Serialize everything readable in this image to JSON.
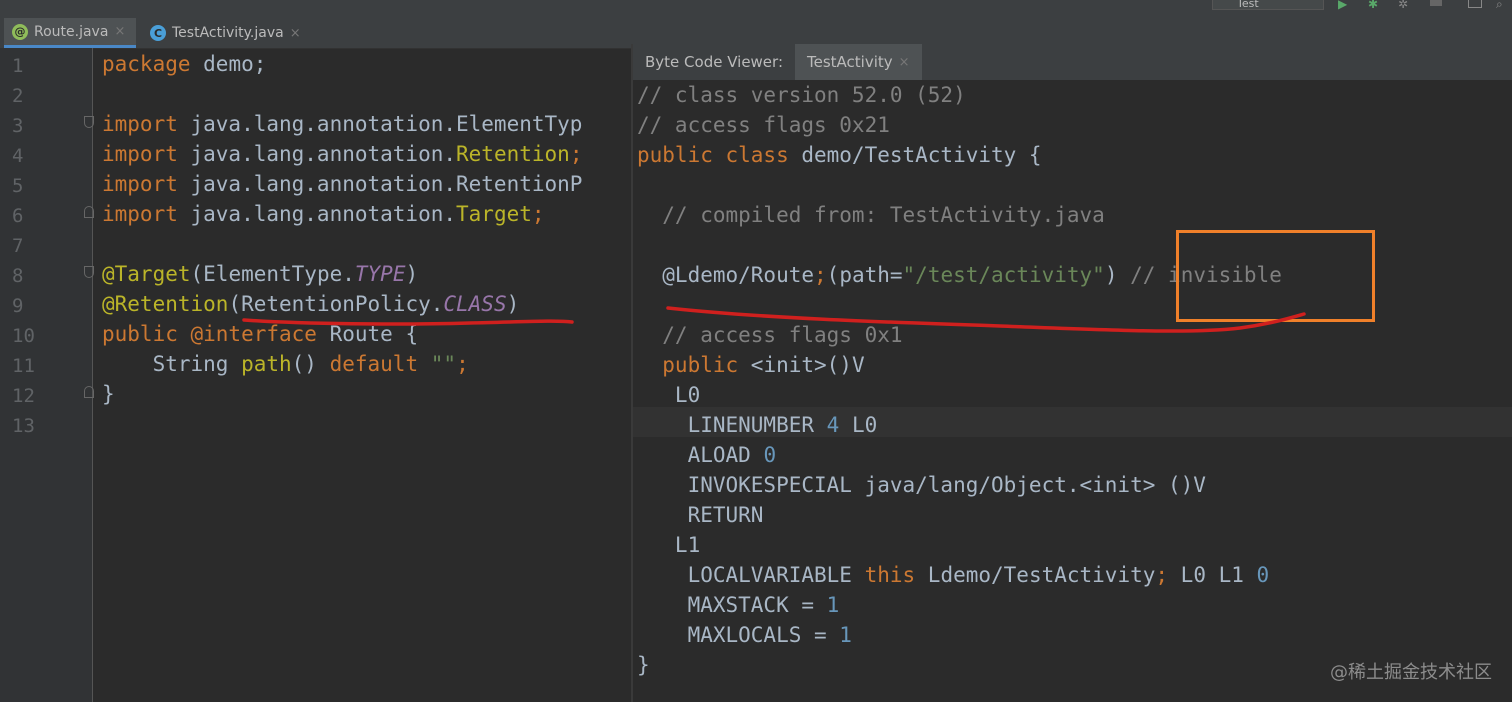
{
  "tabs": [
    {
      "label": "Route.java",
      "icon": "annotation-icon",
      "glyph": "@",
      "color": "#8fbc5a"
    },
    {
      "label": "TestActivity.java",
      "icon": "class-icon",
      "glyph": "C",
      "color": "#4a9fd8"
    }
  ],
  "close_glyph": "×",
  "top_toolbar": {
    "config_label": "Test"
  },
  "line_numbers": [
    "1",
    "2",
    "3",
    "4",
    "5",
    "6",
    "7",
    "8",
    "9",
    "10",
    "11",
    "12",
    "13"
  ],
  "source": {
    "l1_kw": "package",
    "l1_rest": " demo;",
    "l3_kw": "import",
    "l3_rest": " java.lang.annotation.ElementTyp",
    "l4_kw": "import",
    "l4_pkg": " java.lang.annotation.",
    "l4_name": "Retention",
    "l4_end": ";",
    "l5_kw": "import",
    "l5_rest": " java.lang.annotation.RetentionP",
    "l6_kw": "import",
    "l6_pkg": " java.lang.annotation.",
    "l6_name": "Target",
    "l6_end": ";",
    "l8_ann": "@Target",
    "l8_a": "(ElementType.",
    "l8_it": "TYPE",
    "l8_b": ")",
    "l9_ann": "@Retention",
    "l9_a": "(RetentionPolicy.",
    "l9_it": "CLASS",
    "l9_b": ")",
    "l10_kw": "public @interface",
    "l10_rest": " Route {",
    "l11_a": "    String ",
    "l11_fn": "path",
    "l11_b": "() ",
    "l11_kw": "default",
    "l11_c": " ",
    "l11_str": "\"\"",
    "l11_d": ";",
    "l12": "}"
  },
  "bytecode_panel": {
    "title": "Byte Code Viewer:",
    "tab_label": "TestActivity",
    "lines": {
      "b1": "// class version 52.0 (52)",
      "b2": "// access flags 0x21",
      "b3_kw": "public class",
      "b3_rest": " demo/TestActivity {",
      "b5": "  // compiled from: TestActivity.java",
      "b7_a": "  @Ldemo/Route",
      "b7_semi": ";",
      "b7_b": "(path=",
      "b7_str": "\"/test/activity\"",
      "b7_c": ") ",
      "b7_cm": "// invisible",
      "b8": "  // access flags 0x1",
      "b9_kw": "  public",
      "b9_rest": " <init>()V",
      "b10": "   L0",
      "b11_a": "    LINENUMBER ",
      "b11_num": "4",
      "b11_b": " L0",
      "b12_a": "    ALOAD ",
      "b12_num": "0",
      "b13": "    INVOKESPECIAL java/lang/Object.<init> ()V",
      "b14": "    RETURN",
      "b15": "   L1",
      "b16_a": "    LOCALVARIABLE ",
      "b16_kw": "this",
      "b16_b": " Ldemo/TestActivity",
      "b16_semi": ";",
      "b16_c": " L0 L1 ",
      "b16_num": "0",
      "b17_a": "    MAXSTACK = ",
      "b17_num": "1",
      "b18_a": "    MAXLOCALS = ",
      "b18_num": "1",
      "b19": "}"
    }
  },
  "watermark": "@稀土掘金技术社区",
  "colors": {
    "annotation_red": "#d0201e",
    "highlight_orange": "#f0802a"
  }
}
